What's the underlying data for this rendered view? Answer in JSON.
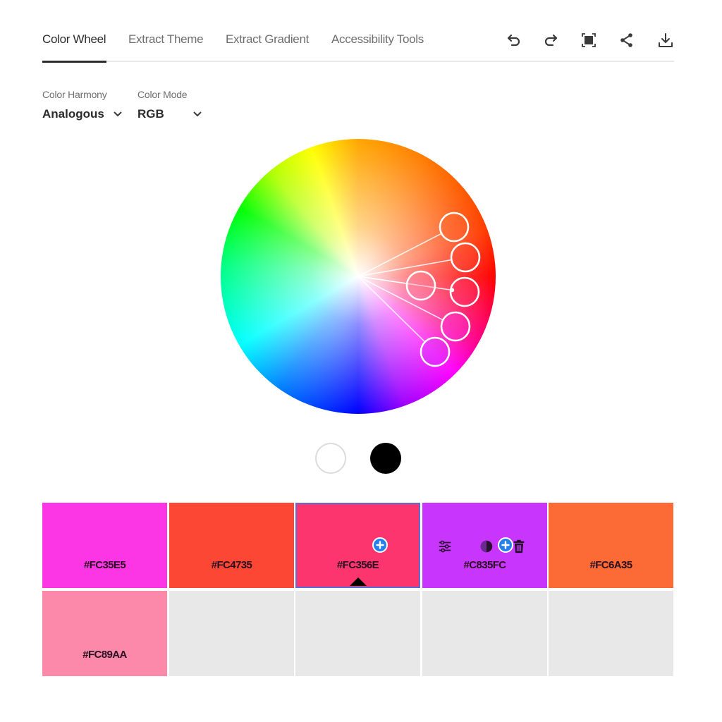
{
  "tabs": [
    {
      "label": "Color Wheel",
      "active": true
    },
    {
      "label": "Extract Theme",
      "active": false
    },
    {
      "label": "Extract Gradient",
      "active": false
    },
    {
      "label": "Accessibility Tools",
      "active": false
    }
  ],
  "toolbar": {
    "icons": [
      "undo-icon",
      "redo-icon",
      "fit-screen-icon",
      "share-icon",
      "download-icon"
    ]
  },
  "controls": {
    "harmony": {
      "label": "Color Harmony",
      "value": "Analogous"
    },
    "mode": {
      "label": "Color Mode",
      "value": "RGB"
    }
  },
  "wheel": {
    "handles": [
      {
        "hex": "#FC6A35",
        "base": false
      },
      {
        "hex": "#FC4735",
        "base": false
      },
      {
        "hex": "#FC89AA",
        "base": false
      },
      {
        "hex": "#FC356E",
        "base": true
      },
      {
        "hex": "#FC35E5",
        "base": false
      },
      {
        "hex": "#C835FC",
        "base": false
      }
    ]
  },
  "brightness": {
    "white_label": "white",
    "black_label": "black"
  },
  "swatches": [
    {
      "hex": "#FC35E5",
      "color": "#FC35E5",
      "selected": false
    },
    {
      "hex": "#FC4735",
      "color": "#FC4735",
      "selected": false
    },
    {
      "hex": "#FC356E",
      "color": "#FC356E",
      "selected": true
    },
    {
      "hex": "#C835FC",
      "color": "#C835FC",
      "selected": false,
      "hovered": true
    },
    {
      "hex": "#FC6A35",
      "color": "#FC6A35",
      "selected": false
    },
    {
      "hex": "#FC89AA",
      "color": "#FC89AA",
      "selected": false
    }
  ],
  "accent": "#2680EB"
}
